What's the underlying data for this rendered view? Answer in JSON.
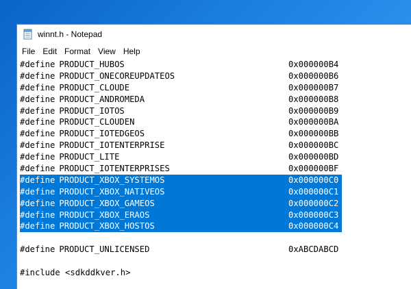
{
  "window": {
    "title": "winnt.h - Notepad"
  },
  "menu": {
    "file": "File",
    "edit": "Edit",
    "format": "Format",
    "view": "View",
    "help": "Help"
  },
  "editor": {
    "lines": [
      {
        "define": "#define",
        "name": "PRODUCT_HUBOS",
        "value": "0x000000B4"
      },
      {
        "define": "#define",
        "name": "PRODUCT_ONECOREUPDATEOS",
        "value": "0x000000B6"
      },
      {
        "define": "#define",
        "name": "PRODUCT_CLOUDE",
        "value": "0x000000B7"
      },
      {
        "define": "#define",
        "name": "PRODUCT_ANDROMEDA",
        "value": "0x000000B8"
      },
      {
        "define": "#define",
        "name": "PRODUCT_IOTOS",
        "value": "0x000000B9"
      },
      {
        "define": "#define",
        "name": "PRODUCT_CLOUDEN",
        "value": "0x000000BA"
      },
      {
        "define": "#define",
        "name": "PRODUCT_IOTEDGEOS",
        "value": "0x000000BB"
      },
      {
        "define": "#define",
        "name": "PRODUCT_IOTENTERPRISE",
        "value": "0x000000BC"
      },
      {
        "define": "#define",
        "name": "PRODUCT_LITE",
        "value": "0x000000BD"
      },
      {
        "define": "#define",
        "name": "PRODUCT_IOTENTERPRISES",
        "value": "0x000000BF"
      },
      {
        "define": "#define",
        "name": "PRODUCT_XBOX_SYSTEMOS",
        "value": "0x000000C0"
      },
      {
        "define": "#define",
        "name": "PRODUCT_XBOX_NATIVEOS",
        "value": "0x000000C1"
      },
      {
        "define": "#define",
        "name": "PRODUCT_XBOX_GAMEOS",
        "value": "0x000000C2"
      },
      {
        "define": "#define",
        "name": "PRODUCT_XBOX_ERAOS",
        "value": "0x000000C3"
      },
      {
        "define": "#define",
        "name": "PRODUCT_XBOX_HOSTOS",
        "value": "0x000000C4"
      },
      {
        "define": "#define",
        "name": "PRODUCT_UNLICENSED",
        "value": "0xABCDABCD"
      }
    ],
    "include_line": "#include <sdkddkver.h>"
  },
  "colors": {
    "selection": "#0078d7",
    "desktop": "#1a7ee0"
  }
}
